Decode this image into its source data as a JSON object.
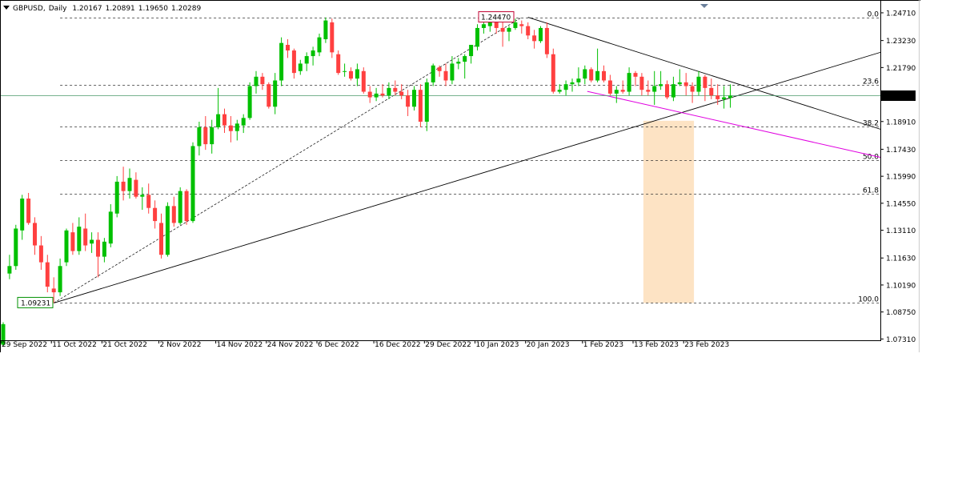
{
  "symbol": "GBPUSD",
  "timeframe": "Daily",
  "ohlc": [
    "1.20167",
    "1.20891",
    "1.19650",
    "1.20289"
  ],
  "colors": {
    "bull": "#00c000",
    "bear": "#ff4040",
    "fib_zone": "#fde3c4",
    "magenta": "#e000e0",
    "price_line": "#4a9a6a",
    "low_label": "#009000",
    "high_label": "#c00030"
  },
  "chart_data": {
    "type": "candlestick",
    "x_tick_labels": [
      "29 Sep 2022",
      "11 Oct 2022",
      "21 Oct 2022",
      "2 Nov 2022",
      "14 Nov 2022",
      "24 Nov 2022",
      "6 Dec 2022",
      "16 Dec 2022",
      "29 Dec 2022",
      "10 Jan 2023",
      "20 Jan 2023",
      "1 Feb 2023",
      "13 Feb 2023",
      "23 Feb 2023"
    ],
    "x_tick_index": [
      0,
      8,
      16,
      25,
      34,
      42,
      50,
      59,
      67,
      75,
      83,
      92,
      100,
      108
    ],
    "y_ticks": [
      "1.24710",
      "1.23230",
      "1.21790",
      "1.18910",
      "1.17430",
      "1.15990",
      "1.14550",
      "1.13110",
      "1.11630",
      "1.10190",
      "1.08750",
      "1.07310"
    ],
    "ylim": [
      1.0724,
      1.2488
    ],
    "current_price": "1.20289",
    "low_label": "1.09231",
    "high_label": "1.24470",
    "fib_levels": [
      {
        "label": "0.0",
        "price": 1.2447
      },
      {
        "label": "23.6",
        "price": 1.20874
      },
      {
        "label": "38.2",
        "price": 1.18649
      },
      {
        "label": "50.0",
        "price": 1.16851
      },
      {
        "label": "61.8",
        "price": 1.15053
      },
      {
        "label": "100.0",
        "price": 1.09231
      }
    ],
    "candles": [
      [
        1.07,
        1.082,
        1.069,
        1.081
      ],
      [
        1.108,
        1.118,
        1.105,
        1.112
      ],
      [
        1.112,
        1.134,
        1.11,
        1.132
      ],
      [
        1.131,
        1.15,
        1.126,
        1.148
      ],
      [
        1.148,
        1.151,
        1.134,
        1.135
      ],
      [
        1.135,
        1.138,
        1.118,
        1.123
      ],
      [
        1.123,
        1.128,
        1.11,
        1.114
      ],
      [
        1.114,
        1.118,
        1.098,
        1.101
      ],
      [
        1.1,
        1.106,
        1.0923,
        1.098
      ],
      [
        1.098,
        1.116,
        1.096,
        1.112
      ],
      [
        1.114,
        1.132,
        1.112,
        1.131
      ],
      [
        1.13,
        1.135,
        1.118,
        1.12
      ],
      [
        1.12,
        1.138,
        1.118,
        1.133
      ],
      [
        1.132,
        1.14,
        1.12,
        1.123
      ],
      [
        1.124,
        1.13,
        1.119,
        1.126
      ],
      [
        1.126,
        1.13,
        1.106,
        1.117
      ],
      [
        1.117,
        1.127,
        1.114,
        1.125
      ],
      [
        1.124,
        1.145,
        1.122,
        1.141
      ],
      [
        1.14,
        1.16,
        1.138,
        1.157
      ],
      [
        1.157,
        1.165,
        1.147,
        1.152
      ],
      [
        1.152,
        1.164,
        1.148,
        1.159
      ],
      [
        1.158,
        1.162,
        1.148,
        1.149
      ],
      [
        1.149,
        1.154,
        1.142,
        1.15
      ],
      [
        1.15,
        1.156,
        1.14,
        1.143
      ],
      [
        1.143,
        1.147,
        1.132,
        1.136
      ],
      [
        1.135,
        1.14,
        1.116,
        1.118
      ],
      [
        1.118,
        1.146,
        1.117,
        1.144
      ],
      [
        1.144,
        1.149,
        1.133,
        1.135
      ],
      [
        1.135,
        1.154,
        1.134,
        1.152
      ],
      [
        1.152,
        1.153,
        1.134,
        1.136
      ],
      [
        1.136,
        1.178,
        1.135,
        1.176
      ],
      [
        1.176,
        1.189,
        1.171,
        1.186
      ],
      [
        1.186,
        1.192,
        1.174,
        1.177
      ],
      [
        1.177,
        1.19,
        1.172,
        1.186
      ],
      [
        1.186,
        1.207,
        1.185,
        1.193
      ],
      [
        1.193,
        1.196,
        1.183,
        1.187
      ],
      [
        1.187,
        1.192,
        1.178,
        1.184
      ],
      [
        1.184,
        1.19,
        1.179,
        1.188
      ],
      [
        1.187,
        1.193,
        1.183,
        1.191
      ],
      [
        1.191,
        1.21,
        1.19,
        1.208
      ],
      [
        1.208,
        1.216,
        1.204,
        1.213
      ],
      [
        1.213,
        1.215,
        1.206,
        1.209
      ],
      [
        1.209,
        1.21,
        1.196,
        1.197
      ],
      [
        1.197,
        1.215,
        1.193,
        1.211
      ],
      [
        1.211,
        1.234,
        1.208,
        1.231
      ],
      [
        1.23,
        1.233,
        1.223,
        1.227
      ],
      [
        1.227,
        1.228,
        1.212,
        1.215
      ],
      [
        1.216,
        1.222,
        1.214,
        1.22
      ],
      [
        1.22,
        1.226,
        1.216,
        1.224
      ],
      [
        1.224,
        1.229,
        1.219,
        1.227
      ],
      [
        1.226,
        1.236,
        1.224,
        1.234
      ],
      [
        1.233,
        1.2446,
        1.231,
        1.243
      ],
      [
        1.242,
        1.244,
        1.223,
        1.226
      ],
      [
        1.225,
        1.227,
        1.214,
        1.215
      ],
      [
        1.216,
        1.22,
        1.213,
        1.216
      ],
      [
        1.216,
        1.218,
        1.211,
        1.212
      ],
      [
        1.212,
        1.22,
        1.208,
        1.217
      ],
      [
        1.216,
        1.218,
        1.204,
        1.205
      ],
      [
        1.205,
        1.208,
        1.199,
        1.202
      ],
      [
        1.202,
        1.207,
        1.2,
        1.204
      ],
      [
        1.204,
        1.209,
        1.202,
        1.203
      ],
      [
        1.203,
        1.21,
        1.201,
        1.207
      ],
      [
        1.207,
        1.211,
        1.203,
        1.205
      ],
      [
        1.205,
        1.209,
        1.201,
        1.203
      ],
      [
        1.203,
        1.206,
        1.192,
        1.197
      ],
      [
        1.197,
        1.208,
        1.195,
        1.206
      ],
      [
        1.206,
        1.209,
        1.186,
        1.189
      ],
      [
        1.189,
        1.212,
        1.184,
        1.21
      ],
      [
        1.21,
        1.22,
        1.208,
        1.219
      ],
      [
        1.218,
        1.219,
        1.213,
        1.216
      ],
      [
        1.216,
        1.22,
        1.208,
        1.211
      ],
      [
        1.211,
        1.224,
        1.209,
        1.22
      ],
      [
        1.22,
        1.223,
        1.217,
        1.221
      ],
      [
        1.221,
        1.225,
        1.212,
        1.224
      ],
      [
        1.224,
        1.23,
        1.22,
        1.23
      ],
      [
        1.229,
        1.241,
        1.227,
        1.239
      ],
      [
        1.239,
        1.245,
        1.236,
        1.241
      ],
      [
        1.24,
        1.2447,
        1.237,
        1.243
      ],
      [
        1.243,
        1.244,
        1.236,
        1.239
      ],
      [
        1.239,
        1.242,
        1.229,
        1.237
      ],
      [
        1.237,
        1.24,
        1.232,
        1.239
      ],
      [
        1.239,
        1.244,
        1.238,
        1.242
      ],
      [
        1.241,
        1.243,
        1.236,
        1.24
      ],
      [
        1.24,
        1.242,
        1.233,
        1.235
      ],
      [
        1.235,
        1.238,
        1.228,
        1.232
      ],
      [
        1.232,
        1.24,
        1.231,
        1.239
      ],
      [
        1.239,
        1.242,
        1.223,
        1.225
      ],
      [
        1.225,
        1.228,
        1.204,
        1.205
      ],
      [
        1.205,
        1.209,
        1.204,
        1.206
      ],
      [
        1.206,
        1.211,
        1.203,
        1.209
      ],
      [
        1.209,
        1.212,
        1.205,
        1.21
      ],
      [
        1.21,
        1.218,
        1.208,
        1.212
      ],
      [
        1.212,
        1.219,
        1.209,
        1.217
      ],
      [
        1.217,
        1.218,
        1.21,
        1.211
      ],
      [
        1.211,
        1.228,
        1.21,
        1.216
      ],
      [
        1.216,
        1.219,
        1.21,
        1.211
      ],
      [
        1.211,
        1.214,
        1.203,
        1.204
      ],
      [
        1.204,
        1.208,
        1.199,
        1.206
      ],
      [
        1.206,
        1.211,
        1.204,
        1.205
      ],
      [
        1.205,
        1.218,
        1.203,
        1.215
      ],
      [
        1.215,
        1.216,
        1.208,
        1.213
      ],
      [
        1.213,
        1.215,
        1.203,
        1.206
      ],
      [
        1.206,
        1.211,
        1.203,
        1.205
      ],
      [
        1.205,
        1.216,
        1.198,
        1.208
      ],
      [
        1.208,
        1.216,
        1.206,
        1.209
      ],
      [
        1.209,
        1.211,
        1.201,
        1.202
      ],
      [
        1.202,
        1.213,
        1.2,
        1.209
      ],
      [
        1.209,
        1.217,
        1.208,
        1.21
      ],
      [
        1.21,
        1.215,
        1.203,
        1.208
      ],
      [
        1.208,
        1.21,
        1.199,
        1.205
      ],
      [
        1.205,
        1.216,
        1.203,
        1.213
      ],
      [
        1.213,
        1.214,
        1.2,
        1.207
      ],
      [
        1.207,
        1.212,
        1.201,
        1.203
      ],
      [
        1.203,
        1.209,
        1.198,
        1.201
      ],
      [
        1.201,
        1.208,
        1.196,
        1.202
      ],
      [
        1.2017,
        1.2089,
        1.1965,
        1.2029
      ]
    ]
  }
}
